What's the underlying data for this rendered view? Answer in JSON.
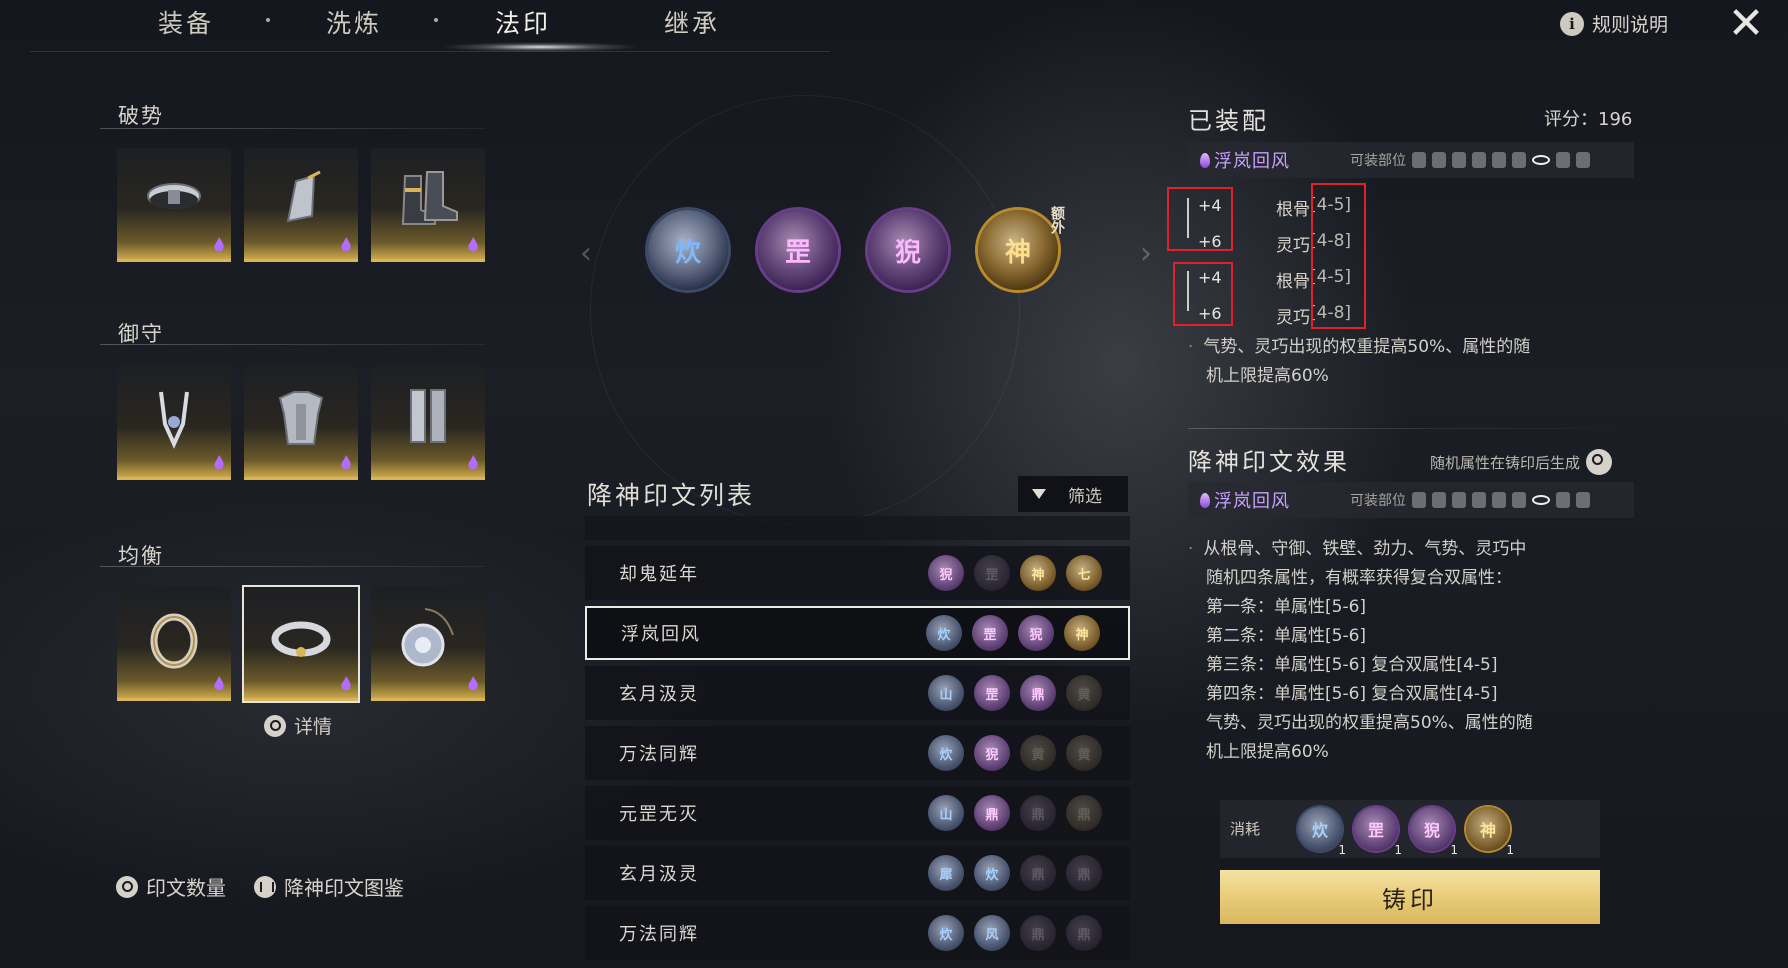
{
  "tabs": [
    {
      "label": "装备",
      "active": false
    },
    {
      "label": "洗炼",
      "active": false
    },
    {
      "label": "法印",
      "active": true
    },
    {
      "label": "继承",
      "active": false
    }
  ],
  "header": {
    "rules_label": "规则说明",
    "info_icon": "i",
    "close_icon": "close-x-icon"
  },
  "equipment": {
    "groups": [
      {
        "title": "破势",
        "items": [
          "waist-belt-icon",
          "bracer-icon",
          "boots-icon"
        ]
      },
      {
        "title": "御守",
        "items": [
          "headpiece-icon",
          "chest-armor-icon",
          "leg-guard-icon"
        ]
      },
      {
        "title": "均衡",
        "items": [
          "ring-icon",
          "bracelet-icon",
          "pendant-icon"
        ]
      }
    ],
    "selected_slot": "bracelet",
    "detail_label": "详情"
  },
  "bottom_links": {
    "rune_count": "印文数量",
    "codex": "降神印文图鉴"
  },
  "center_runes": [
    {
      "glyph": "炊",
      "color": "blue"
    },
    {
      "glyph": "罡",
      "color": "purple"
    },
    {
      "glyph": "猊",
      "color": "purple"
    },
    {
      "glyph": "神",
      "color": "gold",
      "tag": "额外"
    }
  ],
  "rune_list": {
    "title": "降神印文列表",
    "filter_label": "筛选",
    "rows": [
      {
        "name": "却鬼延年",
        "selected": false,
        "orbs": [
          {
            "g": "猊",
            "c": "purple"
          },
          {
            "g": "罡",
            "c": "purple dim"
          },
          {
            "g": "神",
            "c": "gold"
          },
          {
            "g": "七",
            "c": "gold"
          }
        ]
      },
      {
        "name": "浮岚回风",
        "selected": true,
        "orbs": [
          {
            "g": "炊",
            "c": "blue"
          },
          {
            "g": "罡",
            "c": "purple"
          },
          {
            "g": "猊",
            "c": "purple"
          },
          {
            "g": "神",
            "c": "gold"
          }
        ]
      },
      {
        "name": "玄月汲灵",
        "selected": false,
        "orbs": [
          {
            "g": "山",
            "c": "blue"
          },
          {
            "g": "罡",
            "c": "purple"
          },
          {
            "g": "鼎",
            "c": "purple"
          },
          {
            "g": "黄",
            "c": "gold dim"
          }
        ]
      },
      {
        "name": "万法同辉",
        "selected": false,
        "orbs": [
          {
            "g": "炊",
            "c": "blue"
          },
          {
            "g": "猊",
            "c": "purple"
          },
          {
            "g": "黄",
            "c": "gold dim"
          },
          {
            "g": "黄",
            "c": "gold dim"
          }
        ]
      },
      {
        "name": "元罡无灭",
        "selected": false,
        "orbs": [
          {
            "g": "山",
            "c": "blue"
          },
          {
            "g": "鼎",
            "c": "purple"
          },
          {
            "g": "鼎",
            "c": "purple dim"
          },
          {
            "g": "鼎",
            "c": "gold dim"
          }
        ]
      },
      {
        "name": "玄月汲灵",
        "selected": false,
        "orbs": [
          {
            "g": "犀",
            "c": "blue"
          },
          {
            "g": "炊",
            "c": "blue"
          },
          {
            "g": "鼎",
            "c": "purple dim"
          },
          {
            "g": "鼎",
            "c": "purple dim"
          }
        ]
      },
      {
        "name": "万法同辉",
        "selected": false,
        "orbs": [
          {
            "g": "炊",
            "c": "blue"
          },
          {
            "g": "风",
            "c": "blue"
          },
          {
            "g": "鼎",
            "c": "purple dim"
          },
          {
            "g": "鼎",
            "c": "purple dim"
          }
        ]
      }
    ]
  },
  "equipped": {
    "title": "已装配",
    "score_label": "评分：196",
    "rune_name": "浮岚回风",
    "parts_label": "可装部位",
    "stats": [
      {
        "bonus": "+4",
        "name": "根骨",
        "range": "[4-5]"
      },
      {
        "bonus": "+6",
        "name": "灵巧",
        "range": "[4-8]"
      },
      {
        "bonus": "+4",
        "name": "根骨",
        "range": "[4-5]"
      },
      {
        "bonus": "+6",
        "name": "灵巧",
        "range": "[4-8]"
      }
    ],
    "note_line1": "气势、灵巧出现的权重提高50%、属性的随",
    "note_line2": "机上限提高60%"
  },
  "effect": {
    "title": "降神印文效果",
    "hint": "随机属性在铸印后生成",
    "rune_name": "浮岚回风",
    "parts_label": "可装部位",
    "lines": [
      "从根骨、守御、铁壁、劲力、气势、灵巧中",
      "随机四条属性，有概率获得复合双属性：",
      "第一条：单属性[5-6]",
      "第二条：单属性[5-6]",
      "第三条：单属性[5-6] 复合双属性[4-5]",
      "第四条：单属性[5-6] 复合双属性[4-5]",
      "气势、灵巧出现的权重提高50%、属性的随",
      "机上限提高60%"
    ]
  },
  "cost": {
    "label": "消耗",
    "orbs": [
      {
        "g": "炊",
        "c": "blue",
        "n": "1"
      },
      {
        "g": "罡",
        "c": "purple",
        "n": "1"
      },
      {
        "g": "猊",
        "c": "purple",
        "n": "1"
      },
      {
        "g": "神",
        "c": "gold",
        "n": "1"
      }
    ]
  },
  "forge_button": "铸印"
}
